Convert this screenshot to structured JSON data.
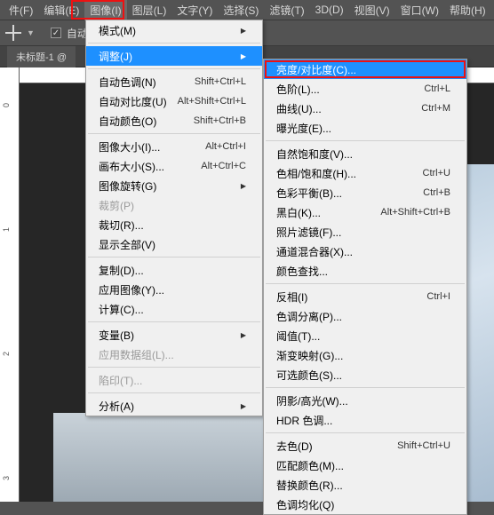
{
  "menubar": {
    "items": [
      "件(F)",
      "编辑(E)",
      "图像(I)",
      "图层(L)",
      "文字(Y)",
      "选择(S)",
      "滤镜(T)",
      "3D(D)",
      "视图(V)",
      "窗口(W)",
      "帮助(H)"
    ],
    "active_index": 2
  },
  "toolbar": {
    "auto_label": "自动"
  },
  "tab": {
    "title": "未标题-1 @"
  },
  "ruler_v": {
    "ticks": [
      "0",
      "1",
      "2",
      "3"
    ]
  },
  "dd1": {
    "groups": [
      [
        {
          "label": "模式(M)",
          "arrow": true
        }
      ],
      [
        {
          "label": "调整(J)",
          "arrow": true,
          "highlight": true
        }
      ],
      [
        {
          "label": "自动色调(N)",
          "shortcut": "Shift+Ctrl+L"
        },
        {
          "label": "自动对比度(U)",
          "shortcut": "Alt+Shift+Ctrl+L"
        },
        {
          "label": "自动颜色(O)",
          "shortcut": "Shift+Ctrl+B"
        }
      ],
      [
        {
          "label": "图像大小(I)...",
          "shortcut": "Alt+Ctrl+I"
        },
        {
          "label": "画布大小(S)...",
          "shortcut": "Alt+Ctrl+C"
        },
        {
          "label": "图像旋转(G)",
          "arrow": true
        },
        {
          "label": "裁剪(P)",
          "disabled": true
        },
        {
          "label": "裁切(R)..."
        },
        {
          "label": "显示全部(V)"
        }
      ],
      [
        {
          "label": "复制(D)..."
        },
        {
          "label": "应用图像(Y)..."
        },
        {
          "label": "计算(C)..."
        }
      ],
      [
        {
          "label": "变量(B)",
          "arrow": true
        },
        {
          "label": "应用数据组(L)...",
          "disabled": true
        }
      ],
      [
        {
          "label": "陷印(T)...",
          "disabled": true
        }
      ],
      [
        {
          "label": "分析(A)",
          "arrow": true
        }
      ]
    ]
  },
  "dd2": {
    "groups": [
      [
        {
          "label": "亮度/对比度(C)...",
          "highlight": true
        },
        {
          "label": "色阶(L)...",
          "shortcut": "Ctrl+L"
        },
        {
          "label": "曲线(U)...",
          "shortcut": "Ctrl+M"
        },
        {
          "label": "曝光度(E)..."
        }
      ],
      [
        {
          "label": "自然饱和度(V)..."
        },
        {
          "label": "色相/饱和度(H)...",
          "shortcut": "Ctrl+U"
        },
        {
          "label": "色彩平衡(B)...",
          "shortcut": "Ctrl+B"
        },
        {
          "label": "黑白(K)...",
          "shortcut": "Alt+Shift+Ctrl+B"
        },
        {
          "label": "照片滤镜(F)..."
        },
        {
          "label": "通道混合器(X)..."
        },
        {
          "label": "颜色查找..."
        }
      ],
      [
        {
          "label": "反相(I)",
          "shortcut": "Ctrl+I"
        },
        {
          "label": "色调分离(P)..."
        },
        {
          "label": "阈值(T)..."
        },
        {
          "label": "渐变映射(G)..."
        },
        {
          "label": "可选颜色(S)..."
        }
      ],
      [
        {
          "label": "阴影/高光(W)..."
        },
        {
          "label": "HDR 色调..."
        }
      ],
      [
        {
          "label": "去色(D)",
          "shortcut": "Shift+Ctrl+U"
        },
        {
          "label": "匹配颜色(M)..."
        },
        {
          "label": "替换颜色(R)..."
        },
        {
          "label": "色调均化(Q)"
        }
      ]
    ]
  }
}
